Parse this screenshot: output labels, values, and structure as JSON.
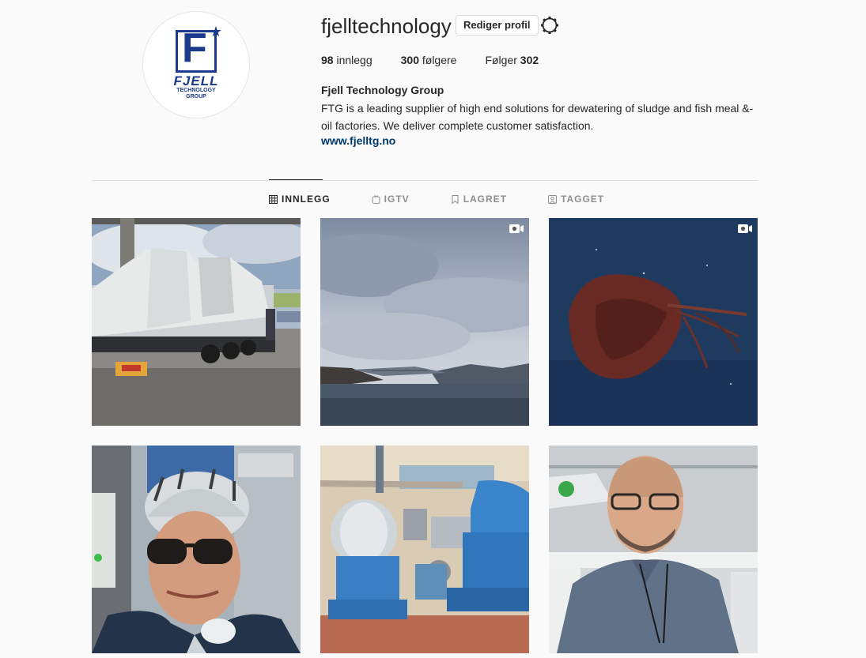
{
  "profile": {
    "username": "fjelltechnology",
    "edit_label": "Rediger profil",
    "logo_text": "F",
    "logo_name": "FJELL",
    "logo_sub1": "TECHNOLOGY",
    "logo_sub2": "GROUP",
    "stats": {
      "posts_count": "98",
      "posts_label": " innlegg",
      "followers_count": "300",
      "followers_label": " følgere",
      "following_label": "Følger ",
      "following_count": "302"
    },
    "full_name": "Fjell Technology Group",
    "bio": "FTG is a leading supplier of high end solutions for dewatering of sludge and fish meal &- oil factories. We deliver complete customer satisfaction.",
    "website": "www.fjelltg.no"
  },
  "tabs": [
    {
      "label": "INNLEGG",
      "icon": "grid-icon",
      "active": true
    },
    {
      "label": "IGTV",
      "icon": "igtv-icon",
      "active": false
    },
    {
      "label": "LAGRET",
      "icon": "bookmark-icon",
      "active": false
    },
    {
      "label": "TAGGET",
      "icon": "tag-icon",
      "active": false
    }
  ],
  "posts": [
    {
      "subject": "truck with wrapped machinery",
      "video": false
    },
    {
      "subject": "fjord landscape with bridge",
      "video": true
    },
    {
      "subject": "deep sea creature",
      "video": true
    },
    {
      "subject": "selfie with bike helmet",
      "video": false
    },
    {
      "subject": "industrial blue machinery",
      "video": false
    },
    {
      "subject": "man with glasses portrait",
      "video": false
    }
  ],
  "colors": {
    "brand": "#1c3a8c",
    "link": "#00376b",
    "text": "#262626",
    "muted": "#8e8e8e",
    "background": "#fafafa"
  }
}
